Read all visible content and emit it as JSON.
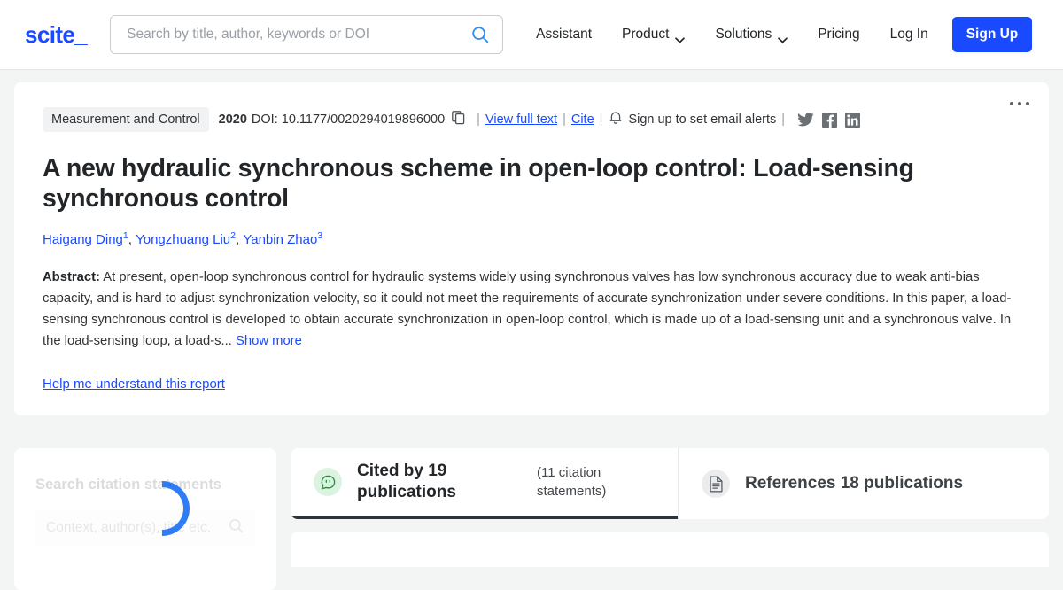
{
  "header": {
    "logo_text": "scite_",
    "search": {
      "placeholder": "Search by title, author, keywords or DOI",
      "value": "",
      "icon": "search-icon"
    },
    "nav": [
      {
        "label": "Assistant",
        "has_caret": false
      },
      {
        "label": "Product",
        "has_caret": true
      },
      {
        "label": "Solutions",
        "has_caret": true
      },
      {
        "label": "Pricing",
        "has_caret": false
      },
      {
        "label": "Log In",
        "has_caret": false
      }
    ],
    "signup_label": "Sign Up",
    "accent_color": "#1a4aff"
  },
  "article": {
    "journal": "Measurement and Control",
    "year": "2020",
    "doi": "DOI: 10.1177/0020294019896000",
    "copy_icon": "copy-icon",
    "view_full_text": "View full text",
    "cite": "Cite",
    "bell_icon": "bell-icon",
    "email_alerts": "Sign up to set email alerts",
    "separator": "|",
    "socials": [
      {
        "name": "twitter-icon"
      },
      {
        "name": "facebook-icon"
      },
      {
        "name": "linkedin-icon"
      }
    ],
    "more_menu": "more-options-icon",
    "title": "A new hydraulic synchronous scheme in open-loop control: Load-sensing synchronous control",
    "authors": [
      {
        "name": "Haigang Ding",
        "affiliation": "1"
      },
      {
        "name": "Yongzhuang Liu",
        "affiliation": "2"
      },
      {
        "name": "Yanbin Zhao",
        "affiliation": "3"
      }
    ],
    "abstract_label": "Abstract:",
    "abstract_text": "At present, open-loop synchronous control for hydraulic systems widely using synchronous valves has low synchronous accuracy due to weak anti-bias capacity, and is hard to adjust synchronization velocity, so it could not meet the requirements of accurate synchronization under severe conditions. In this paper, a load-sensing synchronous control is developed to obtain accurate synchronization in open-loop control, which is made up of a load-sensing unit and a synchronous valve. In the load-sensing loop, a load-s...",
    "show_more": "Show more",
    "help_link": "Help me understand this report"
  },
  "sidebar": {
    "title": "Search citation statements",
    "search_placeholder": "Context, author(s), title etc.",
    "search_icon": "search-icon",
    "loading": true
  },
  "tabs": [
    {
      "id": "cited-by",
      "icon": "citation-bubble-icon",
      "icon_color": "#2f8f46",
      "label": "Cited by 19 publications",
      "sub_label": "(11 citation statements)",
      "active": true
    },
    {
      "id": "references",
      "icon": "document-icon",
      "icon_color": "#5c6166",
      "label": "References 18 publications",
      "sub_label": "",
      "active": false
    }
  ]
}
